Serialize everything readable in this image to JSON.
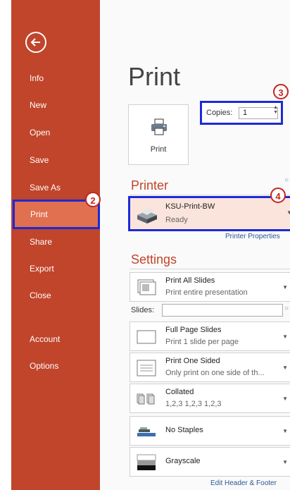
{
  "sidebar": {
    "items": [
      {
        "label": "Info"
      },
      {
        "label": "New"
      },
      {
        "label": "Open"
      },
      {
        "label": "Save"
      },
      {
        "label": "Save As"
      },
      {
        "label": "Print"
      },
      {
        "label": "Share"
      },
      {
        "label": "Export"
      },
      {
        "label": "Close"
      },
      {
        "label": "Account"
      },
      {
        "label": "Options"
      }
    ]
  },
  "main": {
    "title": "Print",
    "print_button_label": "Print",
    "copies_label": "Copies:",
    "copies_value": "1",
    "printer_heading": "Printer",
    "printer_name": "KSU-Print-BW",
    "printer_status": "Ready",
    "printer_properties_link": "Printer Properties",
    "settings_heading": "Settings",
    "slides_label": "Slides:",
    "slides_value": "",
    "edit_header_footer_link": "Edit Header & Footer",
    "settings": [
      {
        "main": "Print All Slides",
        "sub": "Print entire presentation"
      },
      {
        "main": "Full Page Slides",
        "sub": "Print 1 slide per page"
      },
      {
        "main": "Print One Sided",
        "sub": "Only print on one side of th..."
      },
      {
        "main": "Collated",
        "sub": "1,2,3   1,2,3   1,2,3"
      },
      {
        "main": "No Staples"
      },
      {
        "main": "Grayscale"
      }
    ]
  },
  "annotations": {
    "step_print": "2",
    "step_copies": "3",
    "step_printer": "4"
  },
  "colors": {
    "sidebar_bg": "#c0452b",
    "active_item_bg": "#e0704f",
    "highlight_border": "#1b2ad8",
    "badge_red": "#c2261e",
    "printer_bg": "#fbe4dc"
  }
}
